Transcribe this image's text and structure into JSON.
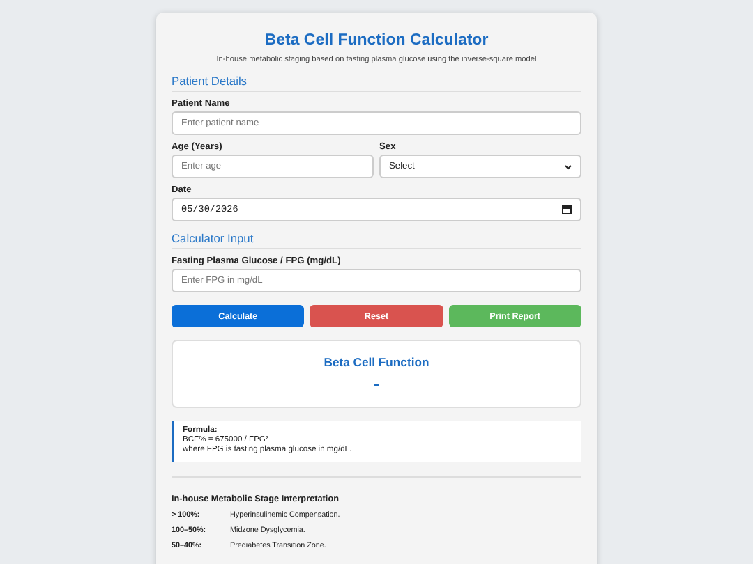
{
  "title": "Beta Cell Function Calculator",
  "subtitle": "In-house metabolic staging based on fasting plasma glucose using the inverse-square model",
  "patient_details": {
    "heading": "Patient Details",
    "name": {
      "label": "Patient Name",
      "placeholder": "Enter patient name"
    },
    "age": {
      "label": "Age (Years)",
      "placeholder": "Enter age"
    },
    "sex": {
      "label": "Sex",
      "value": "Select"
    },
    "date": {
      "label": "Date",
      "value": "05/30/2026"
    }
  },
  "calculator_input": {
    "heading": "Calculator Input",
    "fpg": {
      "label": "Fasting Plasma Glucose / FPG (mg/dL)",
      "placeholder": "Enter FPG in mg/dL"
    }
  },
  "buttons": [
    {
      "label": "Calculate",
      "kind": "primary"
    },
    {
      "label": "Reset",
      "kind": "danger"
    },
    {
      "label": "Print Report",
      "kind": "success"
    }
  ],
  "result": {
    "title": "Beta Cell Function",
    "value": "-"
  },
  "formula": {
    "label": "Formula:",
    "lines": [
      "BCF% = 675000 / FPG²",
      "where FPG is fasting plasma glucose in mg/dL."
    ]
  },
  "interpretation": {
    "heading": "In-house Metabolic Stage Interpretation",
    "rows": [
      {
        "range": "> 100%:",
        "meaning": "Hyperinsulinemic Compensation."
      },
      {
        "range": "100–50%:",
        "meaning": "Midzone Dysglycemia."
      },
      {
        "range": "50–40%:",
        "meaning": "Prediabetes Transition Zone."
      }
    ]
  }
}
